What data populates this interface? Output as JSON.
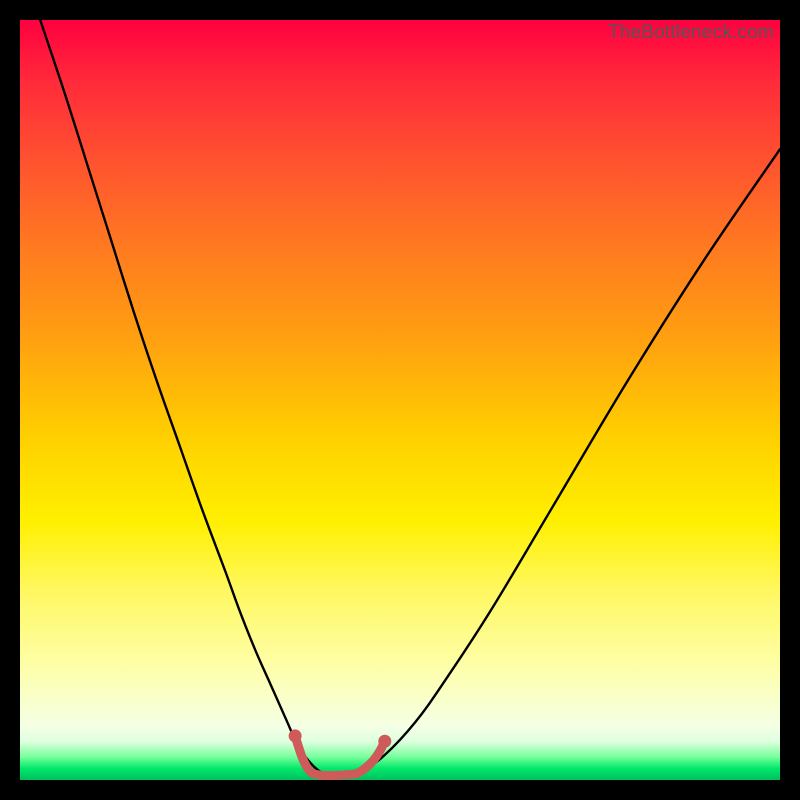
{
  "watermark": "TheBottleneck.com",
  "colors": {
    "frame": "#000000",
    "curve": "#000000",
    "highlight": "#cf5a5a",
    "highlight_dot": "#cf5a5a"
  },
  "chart_data": {
    "type": "line",
    "title": "",
    "xlabel": "",
    "ylabel": "",
    "xlim": [
      0,
      100
    ],
    "ylim": [
      0,
      100
    ],
    "grid": false,
    "legend": false,
    "series": [
      {
        "name": "bottleneck-curve",
        "x": [
          0,
          3,
          6,
          9,
          12,
          15,
          18,
          21,
          24,
          27,
          29,
          31,
          33,
          35,
          36.5,
          38,
          39.5,
          41,
          43,
          45,
          48,
          52,
          56,
          62,
          70,
          80,
          90,
          100
        ],
        "y": [
          108,
          99,
          90,
          80.5,
          71,
          61.5,
          52.5,
          44,
          35.5,
          27.5,
          22,
          17,
          12.5,
          8,
          4.7,
          2.5,
          1.1,
          0.7,
          0.7,
          1.2,
          3.3,
          7.6,
          13.2,
          22.4,
          35.8,
          52.6,
          68.4,
          83
        ]
      }
    ],
    "highlight_segment": {
      "name": "flat-bottom-highlight",
      "points": [
        {
          "x": 36.2,
          "y": 5.8
        },
        {
          "x": 37.2,
          "y": 2.8
        },
        {
          "x": 38.2,
          "y": 1.1
        },
        {
          "x": 39.2,
          "y": 0.7
        },
        {
          "x": 40.2,
          "y": 0.6
        },
        {
          "x": 41.5,
          "y": 0.6
        },
        {
          "x": 43.0,
          "y": 0.7
        },
        {
          "x": 44.4,
          "y": 0.9
        },
        {
          "x": 45.6,
          "y": 1.7
        },
        {
          "x": 46.6,
          "y": 2.7
        },
        {
          "x": 47.4,
          "y": 3.9
        },
        {
          "x": 48.0,
          "y": 5.1
        }
      ]
    }
  }
}
